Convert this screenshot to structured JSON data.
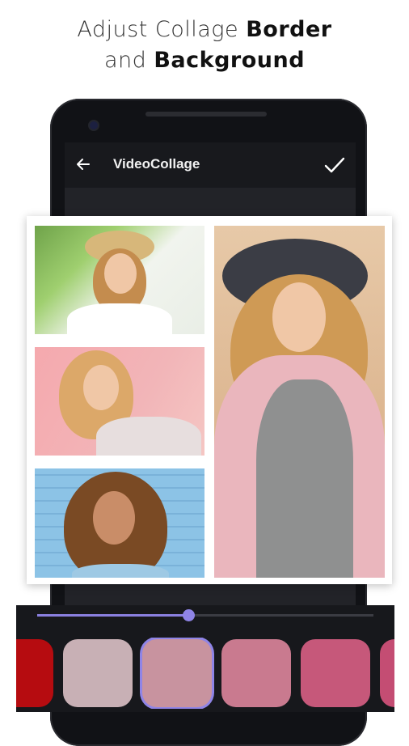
{
  "headline": {
    "line1_light": "Adjust Collage ",
    "line1_bold": "Border",
    "line2_light": "and ",
    "line2_bold": "Background"
  },
  "app_bar": {
    "title": "VideoCollage",
    "back_icon": "arrow-left-icon",
    "confirm_icon": "check-icon"
  },
  "collage": {
    "cells": [
      {
        "name": "photo-woman-straw-hat"
      },
      {
        "name": "photo-woman-pink-background"
      },
      {
        "name": "photo-woman-curly-hair"
      },
      {
        "name": "photo-woman-black-hat"
      }
    ]
  },
  "border_slider": {
    "value_fraction": 0.45
  },
  "background_colors": {
    "selected_index": 2,
    "swatches": [
      "#b60c10",
      "#c8b0b5",
      "#c8939f",
      "#c97a8f",
      "#c6587a",
      "#c44d73"
    ]
  }
}
